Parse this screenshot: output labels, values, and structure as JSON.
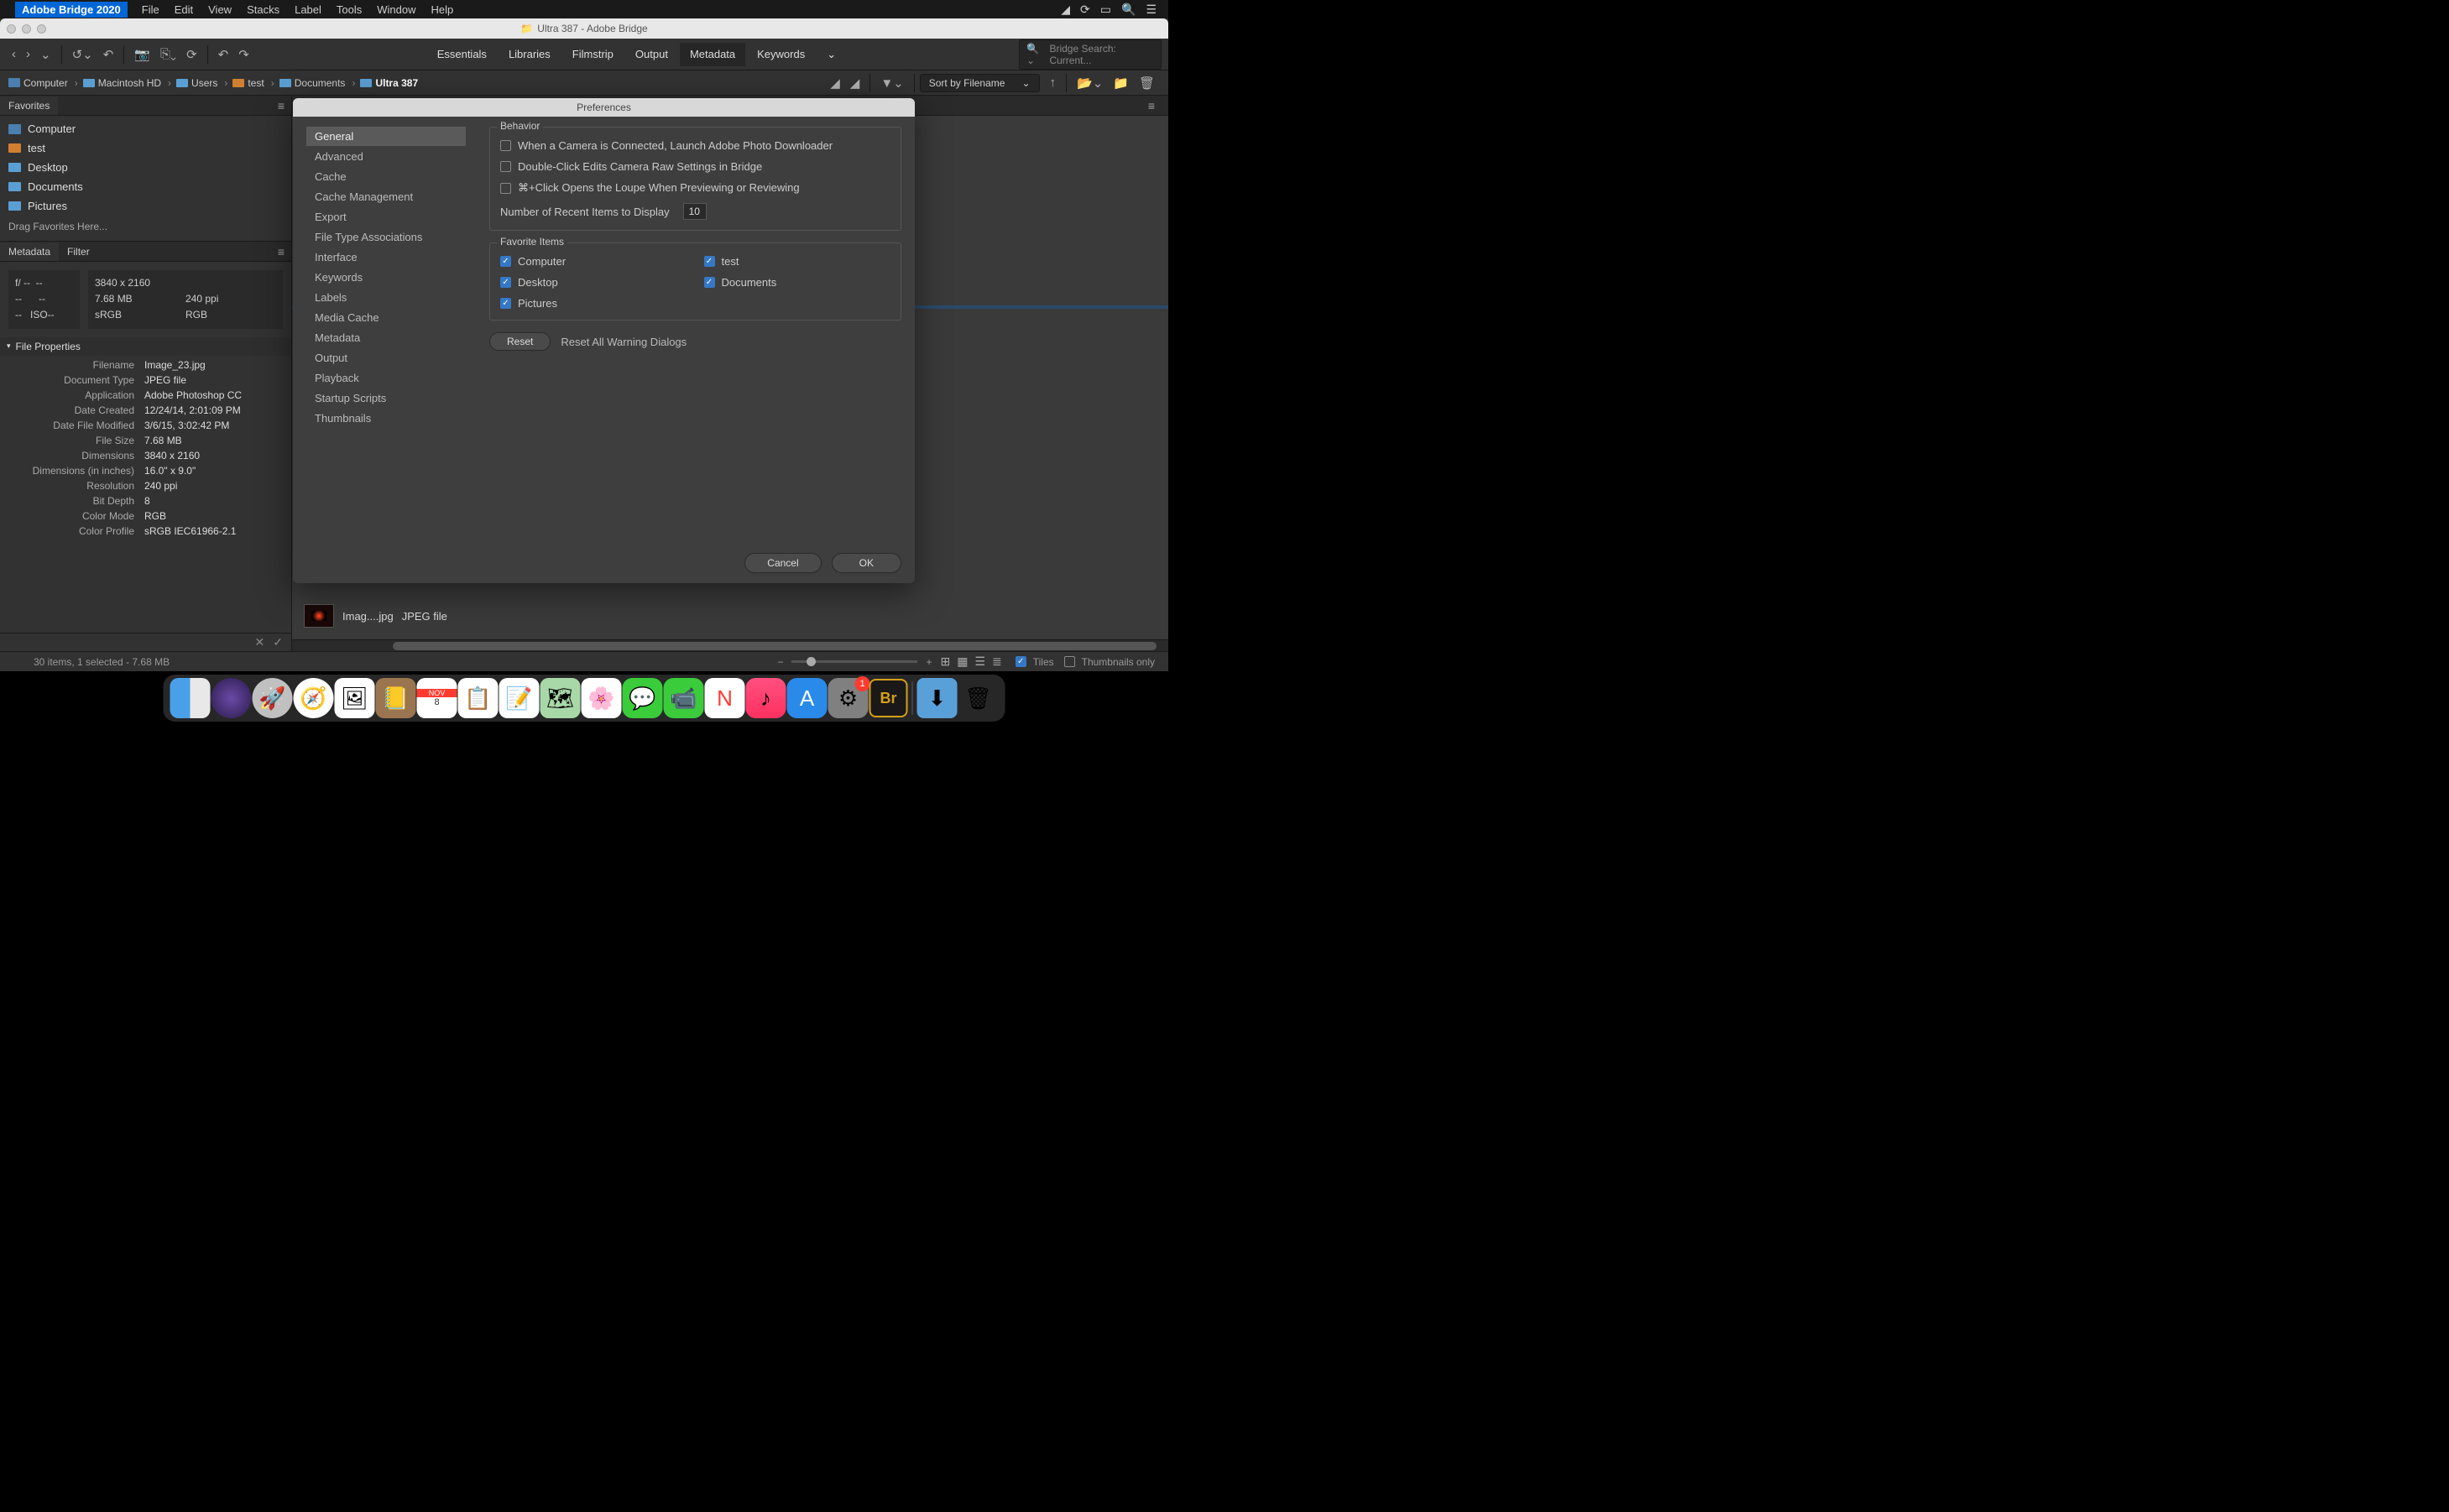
{
  "menubar": {
    "app_name": "Adobe Bridge 2020",
    "items": [
      "File",
      "Edit",
      "View",
      "Stacks",
      "Label",
      "Tools",
      "Window",
      "Help"
    ]
  },
  "window": {
    "title": "Ultra 387 - Adobe Bridge"
  },
  "workspaces": [
    "Essentials",
    "Libraries",
    "Filmstrip",
    "Output",
    "Metadata",
    "Keywords"
  ],
  "active_workspace": "Metadata",
  "search_placeholder": "Bridge Search: Current...",
  "path": [
    "Computer",
    "Macintosh HD",
    "Users",
    "test",
    "Documents",
    "Ultra 387"
  ],
  "sort_label": "Sort by Filename",
  "favorites_tab": "Favorites",
  "favorites": [
    {
      "label": "Computer",
      "icon": "monitor"
    },
    {
      "label": "test",
      "icon": "home"
    },
    {
      "label": "Desktop",
      "icon": "folder"
    },
    {
      "label": "Documents",
      "icon": "folder"
    },
    {
      "label": "Pictures",
      "icon": "folder"
    }
  ],
  "drag_hint": "Drag Favorites Here...",
  "meta_tabs": [
    "Metadata",
    "Filter"
  ],
  "meta_summary": {
    "aperture": "f/ --",
    "exposure": "--",
    "ev1": "--",
    "ev2": "--",
    "awb": "--",
    "iso_label": "ISO",
    "iso_val": "--",
    "dims": "3840 x 2160",
    "size": "7.68 MB",
    "ppi": "240 ppi",
    "cs": "sRGB",
    "mode": "RGB"
  },
  "section_title": "File Properties",
  "props": [
    {
      "k": "Filename",
      "v": "Image_23.jpg"
    },
    {
      "k": "Document Type",
      "v": "JPEG file"
    },
    {
      "k": "Application",
      "v": "Adobe Photoshop CC"
    },
    {
      "k": "Date Created",
      "v": "12/24/14, 2:01:09 PM"
    },
    {
      "k": "Date File Modified",
      "v": "3/6/15, 3:02:42 PM"
    },
    {
      "k": "File Size",
      "v": "7.68 MB"
    },
    {
      "k": "Dimensions",
      "v": "3840 x 2160"
    },
    {
      "k": "Dimensions (in inches)",
      "v": "16.0\" x 9.0\""
    },
    {
      "k": "Resolution",
      "v": "240 ppi"
    },
    {
      "k": "Bit Depth",
      "v": "8"
    },
    {
      "k": "Color Mode",
      "v": "RGB"
    },
    {
      "k": "Color Profile",
      "v": "sRGB IEC61966-2.1"
    }
  ],
  "selected_file": {
    "name": "Imag....jpg",
    "type": "JPEG file"
  },
  "status": "30 items, 1 selected - 7.68 MB",
  "view_labels": {
    "tiles": "Tiles",
    "thumbs": "Thumbnails only"
  },
  "dialog": {
    "title": "Preferences",
    "categories": [
      "General",
      "Advanced",
      "Cache",
      "Cache Management",
      "Export",
      "File Type Associations",
      "Interface",
      "Keywords",
      "Labels",
      "Media Cache",
      "Metadata",
      "Output",
      "Playback",
      "Startup Scripts",
      "Thumbnails"
    ],
    "active_cat": "General",
    "behavior": {
      "title": "Behavior",
      "opt1": "When a Camera is Connected, Launch Adobe Photo Downloader",
      "opt2": "Double-Click Edits Camera Raw Settings in Bridge",
      "opt3": "⌘+Click Opens the Loupe When Previewing or Reviewing",
      "recent_label": "Number of Recent Items to Display",
      "recent_val": "10"
    },
    "fav": {
      "title": "Favorite Items",
      "items": [
        {
          "label": "Computer",
          "checked": true
        },
        {
          "label": "test",
          "checked": true
        },
        {
          "label": "Desktop",
          "checked": true
        },
        {
          "label": "Documents",
          "checked": true
        },
        {
          "label": "Pictures",
          "checked": true
        }
      ]
    },
    "reset": "Reset",
    "reset_warnings": "Reset All Warning Dialogs",
    "cancel": "Cancel",
    "ok": "OK"
  },
  "dock_badge": "1"
}
